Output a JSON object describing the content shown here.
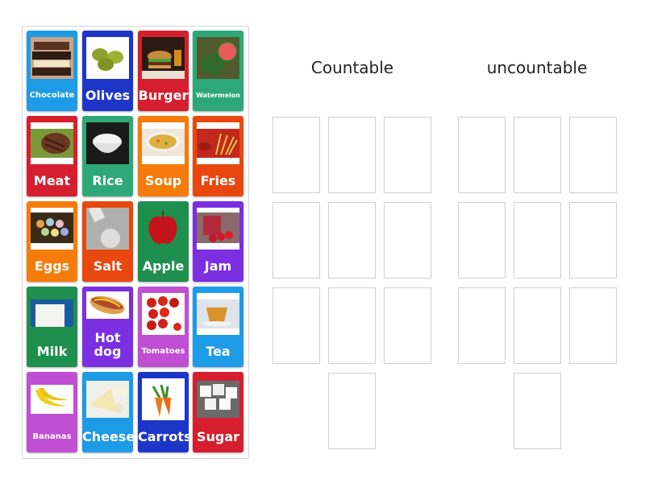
{
  "columns": [
    {
      "title": "Countable"
    },
    {
      "title": "uncountable"
    }
  ],
  "cards": [
    {
      "label": "Chocolate",
      "color": "#1e9be6",
      "size": "small",
      "icon": "chocolate-bar"
    },
    {
      "label": "Olives",
      "color": "#1e36c8",
      "size": "big",
      "icon": "olives"
    },
    {
      "label": "Burger",
      "color": "#d51f2f",
      "size": "big",
      "icon": "burger"
    },
    {
      "label": "Watermelon",
      "color": "#2ea878",
      "size": "tiny",
      "icon": "watermelon"
    },
    {
      "label": "Meat",
      "color": "#d51f2f",
      "size": "big",
      "icon": "steak"
    },
    {
      "label": "Rice",
      "color": "#2ea878",
      "size": "big",
      "icon": "rice-bowl"
    },
    {
      "label": "Soup",
      "color": "#f57c0a",
      "size": "big",
      "icon": "soup-bowl"
    },
    {
      "label": "Fries",
      "color": "#e8480f",
      "size": "big",
      "icon": "fries"
    },
    {
      "label": "Eggs",
      "color": "#f57c0a",
      "size": "big",
      "icon": "eggs-basket"
    },
    {
      "label": "Salt",
      "color": "#e8480f",
      "size": "big",
      "icon": "salt-shaker"
    },
    {
      "label": "Apple",
      "color": "#1f8f4e",
      "size": "big",
      "icon": "apple"
    },
    {
      "label": "Jam",
      "color": "#7b2fe0",
      "size": "big",
      "icon": "jam-jar"
    },
    {
      "label": "Milk",
      "color": "#1f8f4e",
      "size": "big",
      "icon": "milk-glass"
    },
    {
      "label": "Hot dog",
      "color": "#7b2fe0",
      "size": "two",
      "icon": "hotdog"
    },
    {
      "label": "Tomatoes",
      "color": "#c04fd4",
      "size": "small",
      "icon": "tomatoes"
    },
    {
      "label": "Tea",
      "color": "#1e9be6",
      "size": "big",
      "icon": "tea-cup"
    },
    {
      "label": "Bananas",
      "color": "#c04fd4",
      "size": "small",
      "icon": "bananas"
    },
    {
      "label": "Cheese",
      "color": "#1e9be6",
      "size": "big",
      "icon": "cheese"
    },
    {
      "label": "Carrots",
      "color": "#1e36c8",
      "size": "big",
      "icon": "carrots"
    },
    {
      "label": "Sugar",
      "color": "#d51f2f",
      "size": "big",
      "icon": "sugar-cubes"
    }
  ],
  "slots_per_column": 10
}
